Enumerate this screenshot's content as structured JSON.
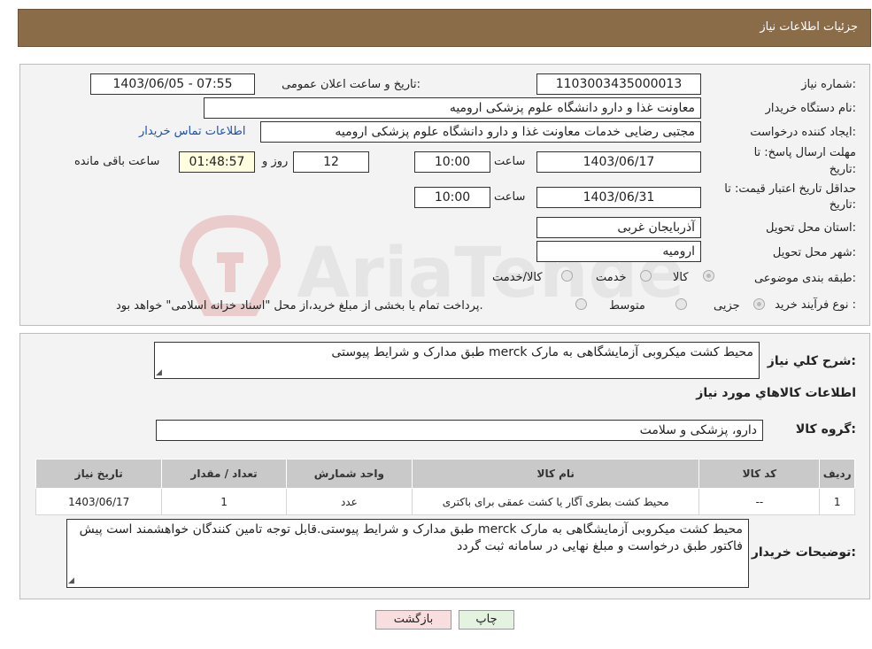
{
  "header": {
    "title": "جزئیات اطلاعات نیاز"
  },
  "form": {
    "need_number_label": "شماره نیاز:",
    "need_number": "1103003435000013",
    "announce_label": "تاریخ و ساعت اعلان عمومی:",
    "announce_value": "1403/06/05 - 07:55",
    "buyer_org_label": "نام دستگاه خریدار:",
    "buyer_org": "معاونت غذا و دارو دانشگاه علوم پزشکی ارومیه",
    "creator_label": "ایجاد کننده درخواست:",
    "creator": "مجتبی رضایی خدمات معاونت غذا و دارو دانشگاه علوم پزشکی ارومیه",
    "contact_link": "اطلاعات تماس خریدار",
    "deadline_label_1": "مهلت ارسال پاسخ: تا",
    "deadline_label_2": "تاریخ:",
    "deadline_date": "1403/06/17",
    "time_label": "ساعت",
    "deadline_time": "10:00",
    "days_value": "12",
    "days_label": "روز و",
    "remaining_time": "01:48:57",
    "remaining_label": "ساعت باقی مانده",
    "validity_label_1": "حداقل تاریخ اعتبار قیمت: تا",
    "validity_label_2": "تاریخ:",
    "validity_date": "1403/06/31",
    "validity_time": "10:00",
    "province_label": "استان محل تحویل:",
    "province": "آذربایجان غربی",
    "city_label": "شهر محل تحویل:",
    "city": "ارومیه",
    "category_label": "طبقه بندی موضوعی:",
    "category_options": [
      "کالا",
      "خدمت",
      "کالا/خدمت"
    ],
    "process_label": "نوع فرآیند خرید :",
    "process_options": [
      "جزیی",
      "متوسط"
    ],
    "process_note": "پرداخت تمام یا بخشی از مبلغ خرید،از محل \"اسناد خزانه اسلامی\" خواهد بود."
  },
  "summary": {
    "label": "شرح کلي نياز:",
    "text": "محیط کشت میکروبی آزمایشگاهی به مارک merck طبق مدارک و شرایط پیوستی",
    "items_title": "اطلاعات کالاهاي مورد نياز",
    "group_label": "گروه کالا:",
    "group_value": "دارو، پزشکی و سلامت"
  },
  "table": {
    "headers": [
      "رديف",
      "کد کالا",
      "نام کالا",
      "واحد شمارش",
      "تعداد / مقدار",
      "تاريخ نياز"
    ],
    "rows": [
      [
        "1",
        "--",
        "محیط کشت بطری آگار یا کشت عمقی برای باکتری",
        "عدد",
        "1",
        "1403/06/17"
      ]
    ]
  },
  "buyer_notes": {
    "label": "توضیحات خریدار:",
    "text": "محیط کشت میکروبی آزمایشگاهی به مارک merck طبق مدارک و شرایط پیوستی.قابل توجه تامین کنندگان خواهشمند است پیش فاکتور طبق درخواست و مبلغ نهایی در سامانه ثبت گردد"
  },
  "buttons": {
    "print": "چاپ",
    "back": "بازگشت"
  },
  "watermark_text": "AriaTender.neT",
  "colors": {
    "header": "#8b6c48",
    "link": "#1a4fb5",
    "back_button": "#f8dede",
    "print_button": "#e3f3df"
  }
}
